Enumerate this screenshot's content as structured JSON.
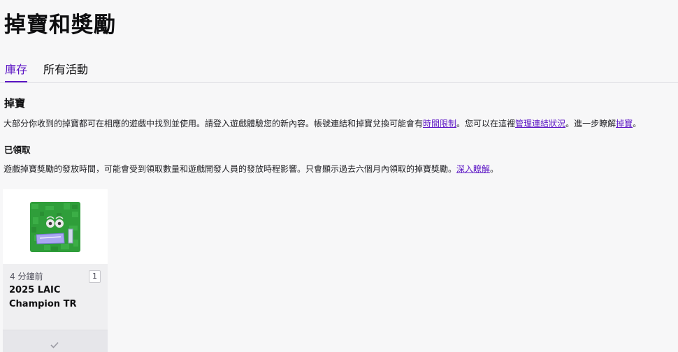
{
  "page": {
    "title": "掉寶和獎勵"
  },
  "tabs": [
    {
      "label": "庫存",
      "active": true
    },
    {
      "label": "所有活動",
      "active": false
    }
  ],
  "drops": {
    "title": "掉寶",
    "description_part1": "大部分你收到的掉寶都可在相應的遊戲中找到並使用。請登入遊戲體驗您的新內容。帳號連結和掉寶兌換可能會有",
    "link_time_limit": "時間限制",
    "description_part2": "。您可以在這裡",
    "link_manage_connections": "管理連結狀況",
    "description_part3": "。進一步瞭解",
    "link_drops": "掉寶",
    "description_part4": "。"
  },
  "claimed": {
    "title": "已領取",
    "description": "遊戲掉寶獎勵的發放時間，可能會受到領取數量和遊戲開發人員的發放時程影響。只會顯示過去六個月內領取的掉寶獎勵。",
    "link_learn_more": "深入瞭解",
    "description_end": "。"
  },
  "reward_card": {
    "time": "4 分鐘前",
    "count": "1",
    "name": "2025 LAIC Champion TR",
    "image_icon": "champion-reward-image",
    "status_icon": "check-icon"
  },
  "colors": {
    "accent": "#5c16c5",
    "background": "#f7f7f8"
  }
}
